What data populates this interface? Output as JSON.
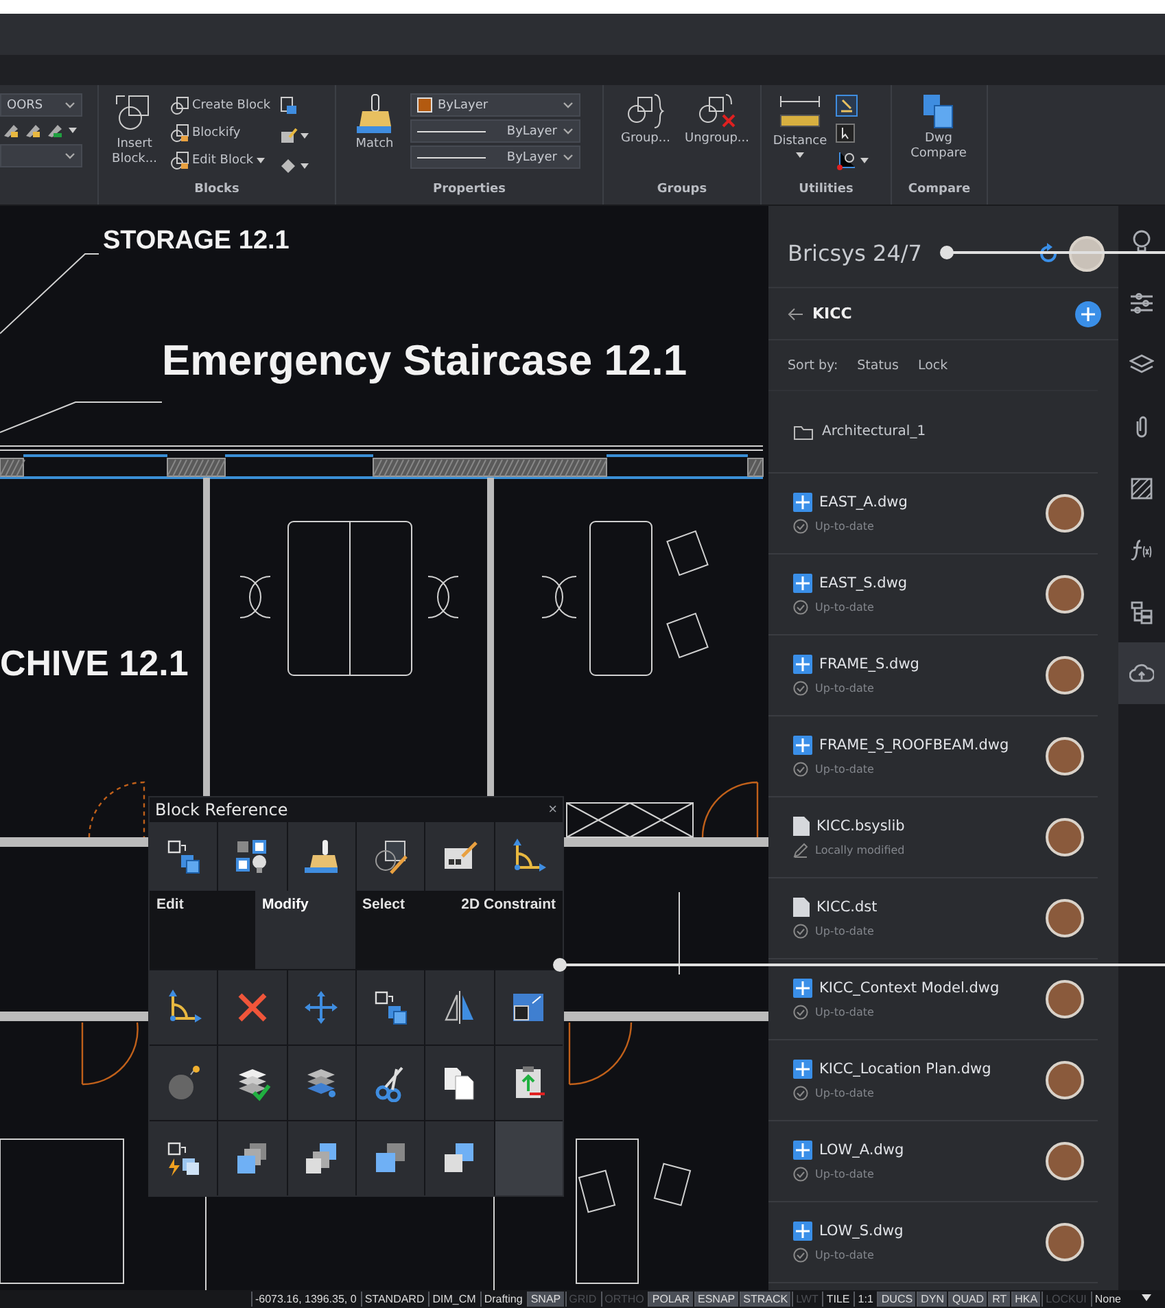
{
  "ribbon": {
    "layers_panel": {
      "layer_dropdown": "OORS"
    },
    "blocks_panel": {
      "insert": "Insert Block...",
      "create": "Create Block",
      "blockify": "Blockify",
      "edit": "Edit Block",
      "title": "Blocks"
    },
    "properties_panel": {
      "match": "Match",
      "color_dropdown": "ByLayer",
      "linetype_dropdown": "ByLayer",
      "lineweight_dropdown": "ByLayer",
      "title": "Properties"
    },
    "groups_panel": {
      "group": "Group...",
      "ungroup": "Ungroup...",
      "title": "Groups"
    },
    "utilities_panel": {
      "distance": "Distance",
      "title": "Utilities"
    },
    "compare_panel": {
      "compare": "Dwg Compare",
      "title": "Compare"
    }
  },
  "drawing": {
    "labels": [
      "STORAGE 12.1",
      "Emergency Staircase 12.1",
      "CHIVE 12.1"
    ]
  },
  "block_palette": {
    "title": "Block Reference",
    "close": "×",
    "tabs": [
      {
        "label": "Edit",
        "selected": false
      },
      {
        "label": "Modify",
        "selected": true
      },
      {
        "label": "Select",
        "selected": false
      },
      {
        "label": "2D Constraint",
        "selected": false
      }
    ]
  },
  "cloud_panel": {
    "title": "Bricsys 24/7",
    "project": "KICC",
    "sort_label": "Sort by:",
    "sort_options": [
      "Status",
      "Lock"
    ],
    "folder": "Architectural_1",
    "files": [
      {
        "name": "EAST_A.dwg",
        "kind": "dwg",
        "status": {
          "kind": "synced",
          "label": "Up-to-date"
        }
      },
      {
        "name": "EAST_S.dwg",
        "kind": "dwg",
        "status": {
          "kind": "synced",
          "label": "Up-to-date"
        }
      },
      {
        "name": "FRAME_S.dwg",
        "kind": "dwg",
        "status": {
          "kind": "synced",
          "label": "Up-to-date"
        }
      },
      {
        "name": "FRAME_S_ROOFBEAM.dwg",
        "kind": "dwg",
        "status": {
          "kind": "synced",
          "label": "Up-to-date"
        }
      },
      {
        "name": "KICC.bsyslib",
        "kind": "doc",
        "status": {
          "kind": "modified",
          "label": "Locally modified"
        }
      },
      {
        "name": "KICC.dst",
        "kind": "doc",
        "status": {
          "kind": "synced",
          "label": "Up-to-date"
        }
      },
      {
        "name": "KICC_Context Model.dwg",
        "kind": "dwg",
        "status": {
          "kind": "synced",
          "label": "Up-to-date"
        }
      },
      {
        "name": "KICC_Location Plan.dwg",
        "kind": "dwg",
        "status": {
          "kind": "synced",
          "label": "Up-to-date"
        }
      },
      {
        "name": "LOW_A.dwg",
        "kind": "dwg",
        "status": {
          "kind": "synced",
          "label": "Up-to-date"
        }
      },
      {
        "name": "LOW_S.dwg",
        "kind": "dwg",
        "status": {
          "kind": "synced",
          "label": "Up-to-date"
        }
      }
    ]
  },
  "tool_strip": [
    {
      "kind": "bulb",
      "selected": false
    },
    {
      "kind": "sliders",
      "selected": false
    },
    {
      "kind": "layers",
      "selected": false
    },
    {
      "kind": "clip",
      "selected": false
    },
    {
      "kind": "hatch",
      "selected": false
    },
    {
      "kind": "formula",
      "selected": false
    },
    {
      "kind": "tree",
      "selected": false
    },
    {
      "kind": "cloud",
      "selected": true
    }
  ],
  "status_bar": [
    {
      "kind": "text",
      "label": "-6073.16, 1396.35, 0"
    },
    {
      "kind": "text",
      "label": "STANDARD"
    },
    {
      "kind": "text",
      "label": "DIM_CM"
    },
    {
      "kind": "text",
      "label": "Drafting"
    },
    {
      "kind": "toggle",
      "label": "SNAP",
      "on": true
    },
    {
      "kind": "toggle",
      "label": "GRID",
      "on": false
    },
    {
      "kind": "toggle",
      "label": "ORTHO",
      "on": false
    },
    {
      "kind": "toggle",
      "label": "POLAR",
      "on": true
    },
    {
      "kind": "toggle",
      "label": "ESNAP",
      "on": true
    },
    {
      "kind": "toggle",
      "label": "STRACK",
      "on": true
    },
    {
      "kind": "toggle",
      "label": "LWT",
      "on": false
    },
    {
      "kind": "text",
      "label": "TILE"
    },
    {
      "kind": "text",
      "label": "1:1"
    },
    {
      "kind": "toggle",
      "label": "DUCS",
      "on": true
    },
    {
      "kind": "toggle",
      "label": "DYN",
      "on": true
    },
    {
      "kind": "toggle",
      "label": "QUAD",
      "on": true
    },
    {
      "kind": "toggle",
      "label": "RT",
      "on": true
    },
    {
      "kind": "toggle",
      "label": "HKA",
      "on": true
    },
    {
      "kind": "toggle",
      "label": "LOCKUI",
      "on": false
    },
    {
      "kind": "text",
      "label": "None"
    }
  ]
}
